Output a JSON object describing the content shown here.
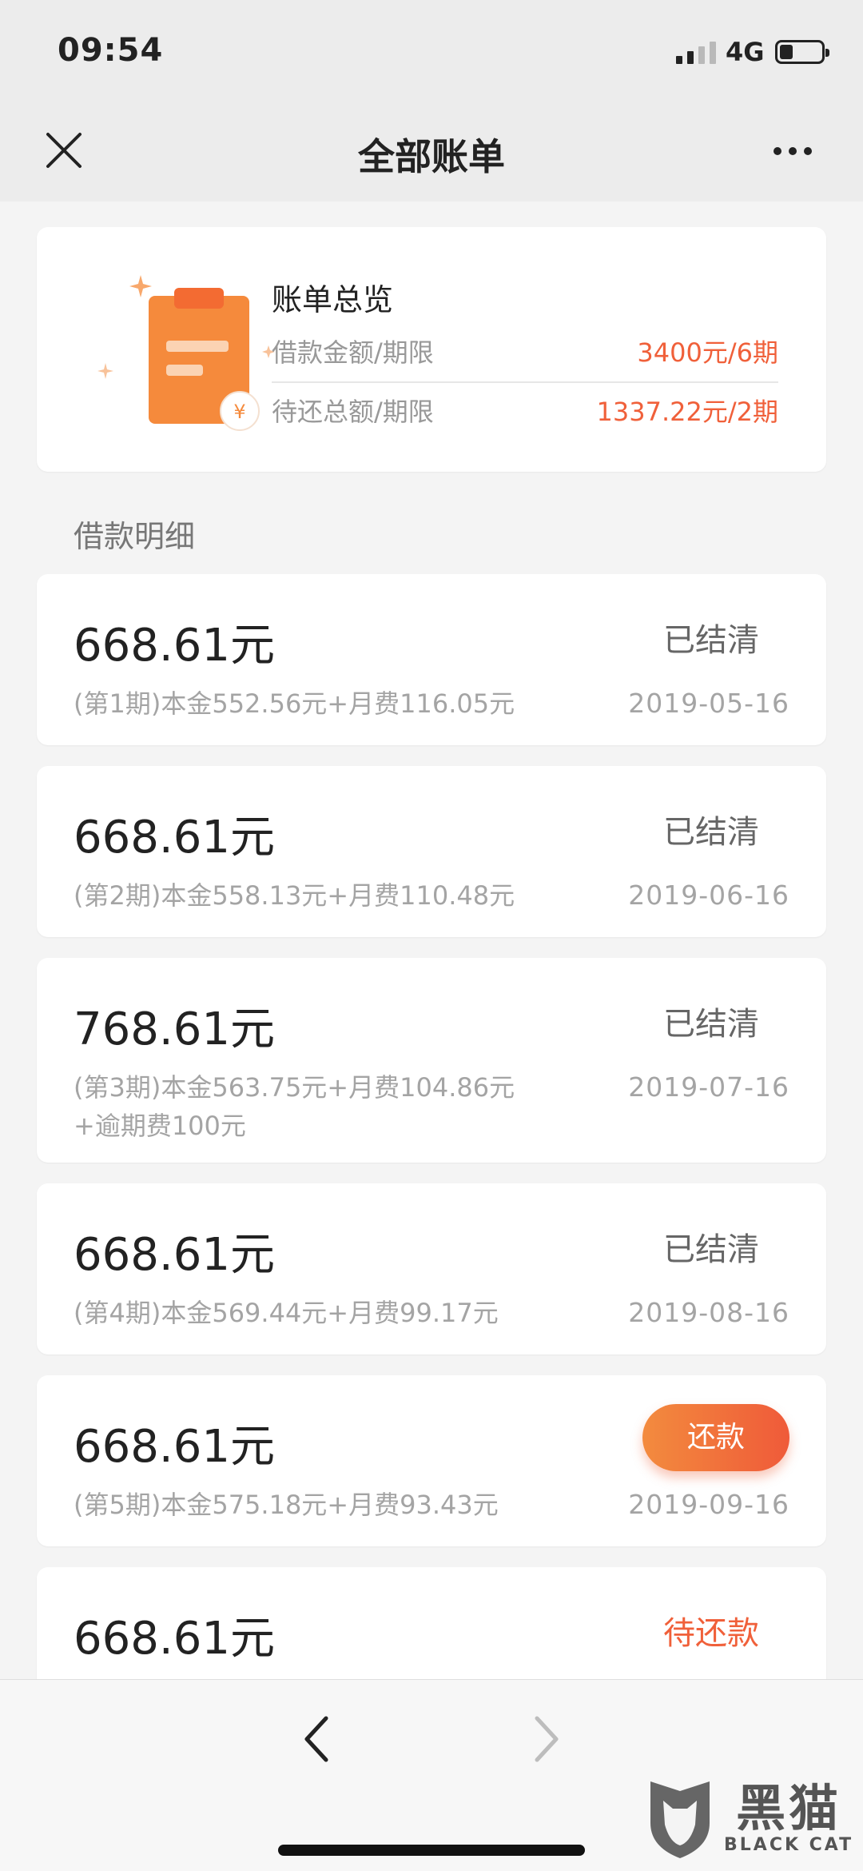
{
  "status_bar": {
    "time": "09:54",
    "network": "4G"
  },
  "nav": {
    "title": "全部账单"
  },
  "overview": {
    "title": "账单总览",
    "rows": [
      {
        "label": "借款金额/期限",
        "value": "3400元/6期"
      },
      {
        "label": "待还总额/期限",
        "value": "1337.22元/2期"
      }
    ],
    "icon_currency": "¥"
  },
  "section_title": "借款明细",
  "bills": [
    {
      "amount": "668.61元",
      "status": "已结清",
      "detail": "(第1期)本金552.56元+月费116.05元",
      "date": "2019-05-16"
    },
    {
      "amount": "668.61元",
      "status": "已结清",
      "detail": "(第2期)本金558.13元+月费110.48元",
      "date": "2019-06-16"
    },
    {
      "amount": "768.61元",
      "status": "已结清",
      "detail": "(第3期)本金563.75元+月费104.86元\n+逾期费100元",
      "date": "2019-07-16"
    },
    {
      "amount": "668.61元",
      "status": "已结清",
      "detail": "(第4期)本金569.44元+月费99.17元",
      "date": "2019-08-16"
    },
    {
      "amount": "668.61元",
      "button": "还款",
      "detail": "(第5期)本金575.18元+月费93.43元",
      "date": "2019-09-16"
    },
    {
      "amount": "668.61元",
      "status": "待还款"
    }
  ],
  "watermark": {
    "cn": "黑猫",
    "en": "BLACK CAT"
  },
  "colors": {
    "accent": "#f0603a",
    "icon_orange": "#f58a3c"
  }
}
